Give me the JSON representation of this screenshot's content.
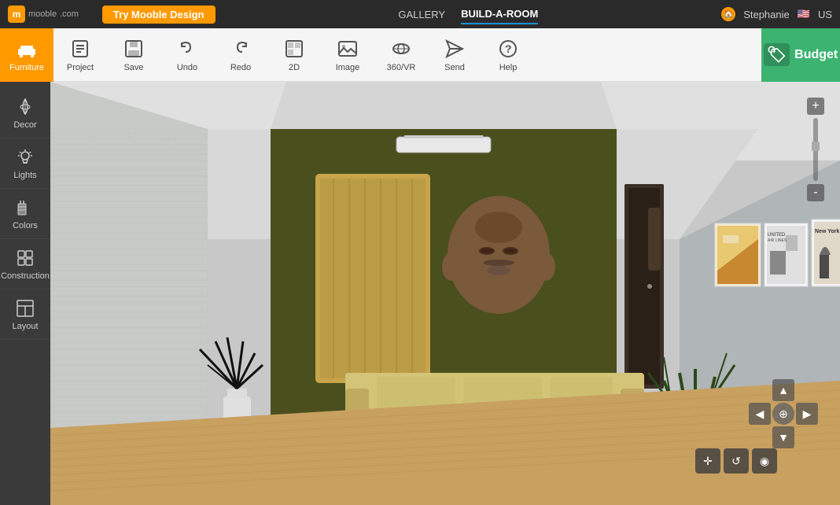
{
  "app": {
    "logo_text": "mooble",
    "logo_sub": ".com",
    "try_button": "Try Mooble Design"
  },
  "top_nav": {
    "links": [
      {
        "label": "GALLERY",
        "active": false
      },
      {
        "label": "BUILD-A-ROOM",
        "active": true
      }
    ],
    "user": "Stephanie",
    "locale": "US"
  },
  "toolbar": {
    "items": [
      {
        "id": "furniture",
        "label": "Furniture",
        "active": true
      },
      {
        "id": "project",
        "label": "Project",
        "active": false
      },
      {
        "id": "save",
        "label": "Save",
        "active": false
      },
      {
        "id": "undo",
        "label": "Undo",
        "active": false
      },
      {
        "id": "redo",
        "label": "Redo",
        "active": false
      },
      {
        "id": "2d",
        "label": "2D",
        "active": false
      },
      {
        "id": "image",
        "label": "Image",
        "active": false
      },
      {
        "id": "360vr",
        "label": "360/VR",
        "active": false
      },
      {
        "id": "send",
        "label": "Send",
        "active": false
      },
      {
        "id": "help",
        "label": "Help",
        "active": false
      }
    ],
    "budget_label": "Budget"
  },
  "sidebar": {
    "items": [
      {
        "id": "decor",
        "label": "Decor"
      },
      {
        "id": "lights",
        "label": "Lights"
      },
      {
        "id": "colors",
        "label": "Colors"
      },
      {
        "id": "construction",
        "label": "Construction"
      },
      {
        "id": "layout",
        "label": "Layout"
      }
    ]
  },
  "viewport": {
    "scene": "3d_room"
  },
  "nav_controls": {
    "up": "▲",
    "down": "▼",
    "left": "◀",
    "right": "▶",
    "zoom_in": "+",
    "zoom_out": "-"
  }
}
